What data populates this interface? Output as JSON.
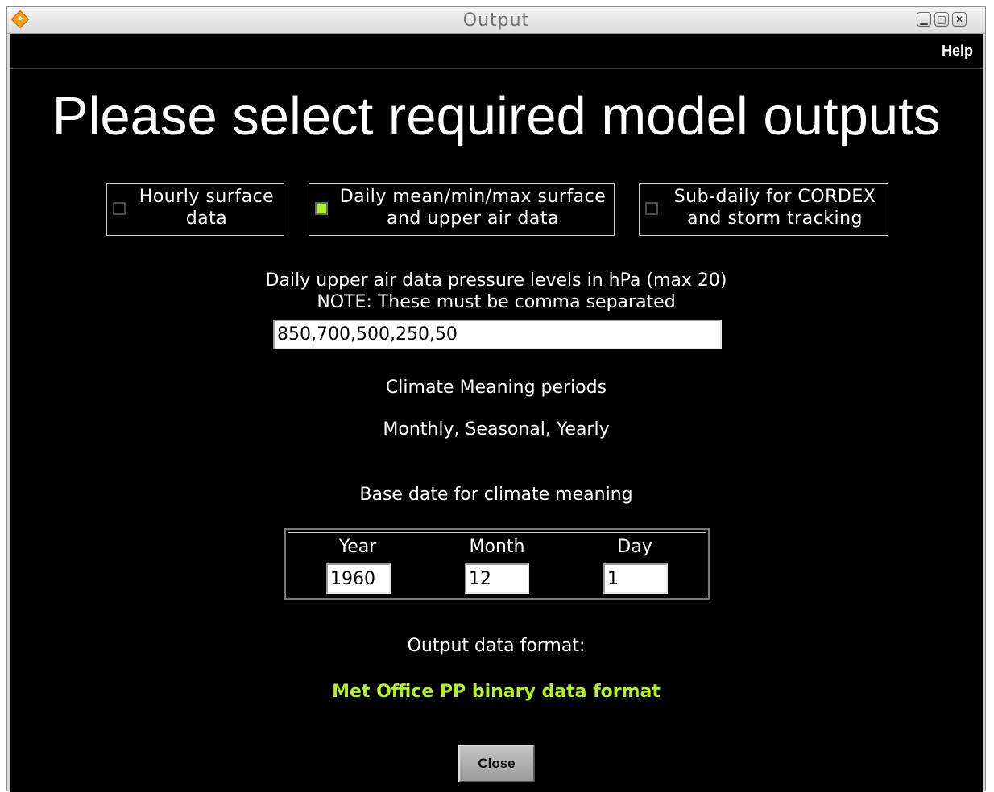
{
  "window": {
    "title": "Output"
  },
  "menubar": {
    "help_label": "Help"
  },
  "heading": "Please select required model outputs",
  "options": [
    {
      "label": "Hourly surface\ndata",
      "checked": false
    },
    {
      "label": "Daily mean/min/max surface\nand upper air data",
      "checked": true
    },
    {
      "label": "Sub-daily for CORDEX\nand storm tracking",
      "checked": false
    }
  ],
  "pressure": {
    "label": "Daily upper air data pressure levels in hPa (max 20)\nNOTE: These must be comma separated",
    "value": "850,700,500,250,50"
  },
  "climate_meaning": {
    "label": "Climate Meaning periods",
    "periods": "Monthly, Seasonal, Yearly"
  },
  "base_date": {
    "label": "Base date for climate meaning",
    "year_label": "Year",
    "year_value": "1960",
    "month_label": "Month",
    "month_value": "12",
    "day_label": "Day",
    "day_value": "1"
  },
  "output_format": {
    "label": "Output data format:",
    "value": "Met Office PP binary data format"
  },
  "close_label": "Close",
  "colors": {
    "background": "#000000",
    "text": "#ffffff",
    "accent_green": "#b5ee2a"
  }
}
